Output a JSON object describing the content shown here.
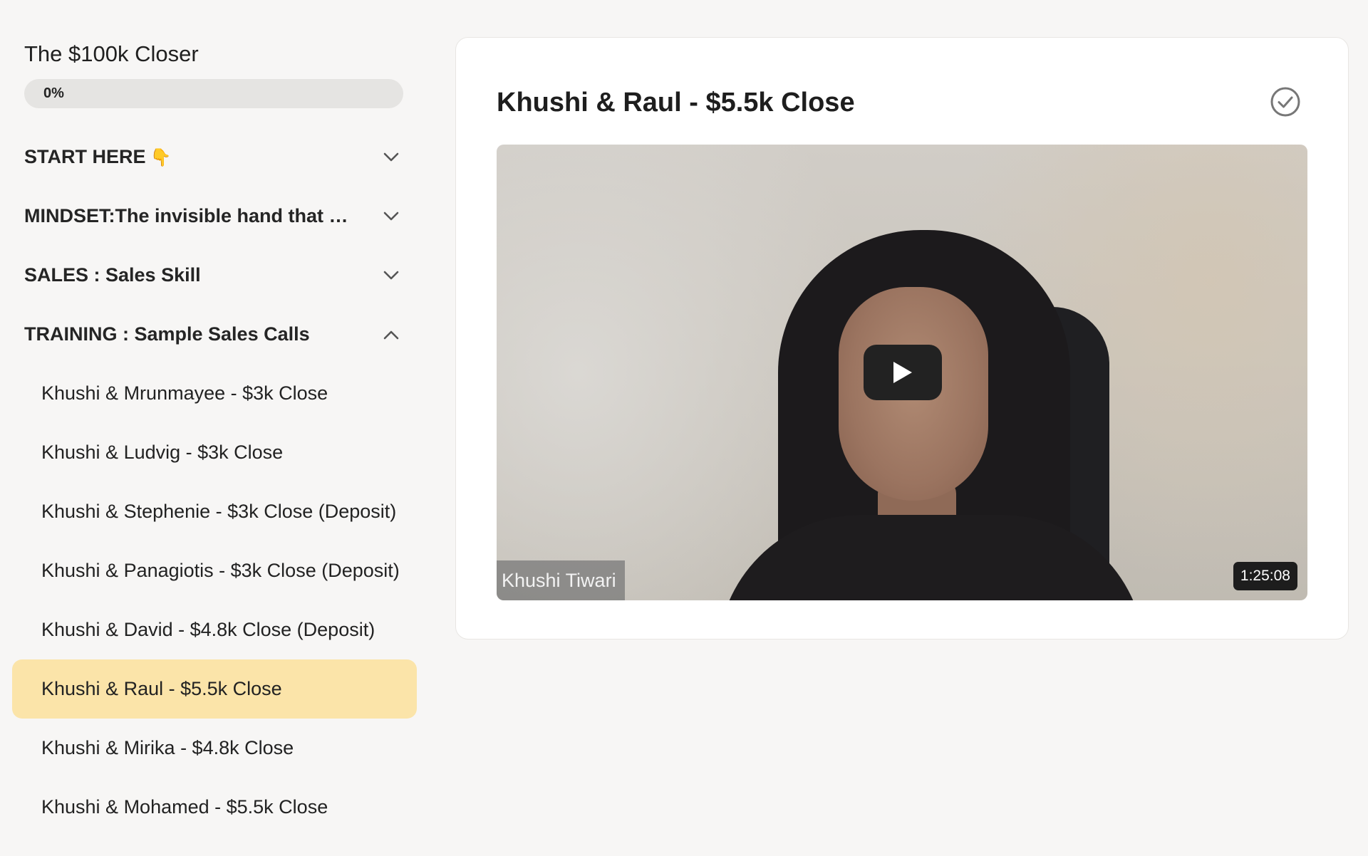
{
  "course": {
    "title": "The $100k Closer",
    "progress_label": "0%",
    "progress_fraction": 0
  },
  "modules": [
    {
      "title": "START HERE",
      "emoji": "👇",
      "expanded": false
    },
    {
      "title": "MINDSET:The invisible hand that w...",
      "expanded": false
    },
    {
      "title": "SALES : Sales Skill",
      "expanded": false
    },
    {
      "title": "TRAINING : Sample Sales Calls",
      "expanded": true
    }
  ],
  "lessons": [
    {
      "title": "Khushi & Mrunmayee - $3k Close"
    },
    {
      "title": "Khushi & Ludvig - $3k Close"
    },
    {
      "title": "Khushi & Stephenie - $3k Close (Deposit)"
    },
    {
      "title": "Khushi & Panagiotis - $3k Close (Deposit)"
    },
    {
      "title": "Khushi & David - $4.8k Close (Deposit)"
    },
    {
      "title": "Khushi & Raul - $5.5k Close",
      "active": true
    },
    {
      "title": "Khushi & Mirika - $4.8k Close"
    },
    {
      "title": "Khushi & Mohamed - $5.5k Close"
    }
  ],
  "main": {
    "lesson_title": "Khushi & Raul - $5.5k Close",
    "complete_icon": "check-circle-icon",
    "video": {
      "presenter_name": "Khushi Tiwari",
      "duration": "1:25:08",
      "play_icon": "play-icon"
    }
  },
  "colors": {
    "active_lesson_bg": "#fbe4a9",
    "page_bg": "#f7f6f5",
    "progress_track": "#e5e4e2"
  }
}
